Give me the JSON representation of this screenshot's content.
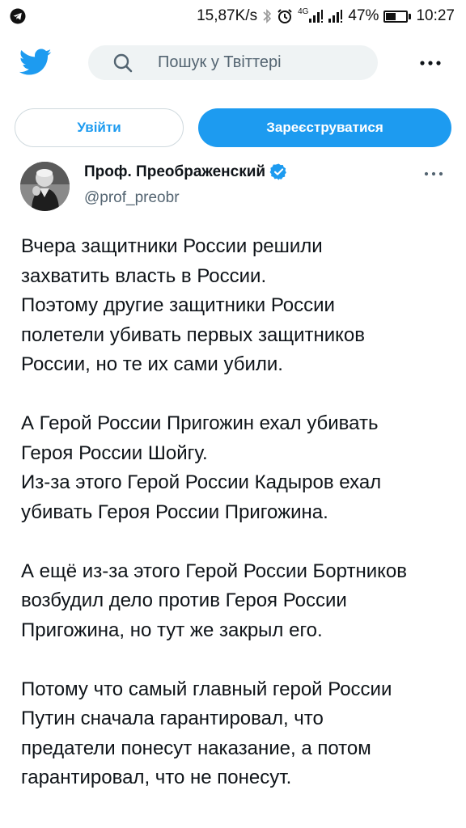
{
  "status_bar": {
    "speed": "15,87K/s",
    "network": "4G",
    "battery": "47%",
    "battery_level": 0.47,
    "time": "10:27"
  },
  "header": {
    "logo": "twitter-bird-icon",
    "search_placeholder": "Пошук у Твіттері",
    "more_icon": "more-horizontal-icon"
  },
  "auth": {
    "login_label": "Увійти",
    "signup_label": "Зареєструватися"
  },
  "tweet": {
    "author_name": "Проф. Преображенский",
    "author_handle": "@prof_preobr",
    "verified": true,
    "paragraphs": [
      [
        "Вчера защитники России решили",
        "захватить власть в России.",
        "Поэтому другие защитники России",
        "полетели убивать первых защитников",
        "России, но те их сами убили."
      ],
      [
        "А Герой России Пригожин ехал убивать",
        "Героя России Шойгу.",
        "Из-за этого Герой России Кадыров ехал",
        "убивать Героя России Пригожина."
      ],
      [
        "А ещё из-за этого Герой России Бортников",
        "возбудил дело против Героя России",
        "Пригожина, но тут же закрыл его."
      ],
      [
        "Потому что самый главный герой России",
        "Путин сначала гарантировал, что",
        "предатели понесут наказание, а потом",
        "гарантировал, что не понесут."
      ]
    ]
  },
  "colors": {
    "accent": "#1d9bf0",
    "text": "#0f1419",
    "secondary_text": "#536471",
    "search_bg": "#eff3f4"
  }
}
